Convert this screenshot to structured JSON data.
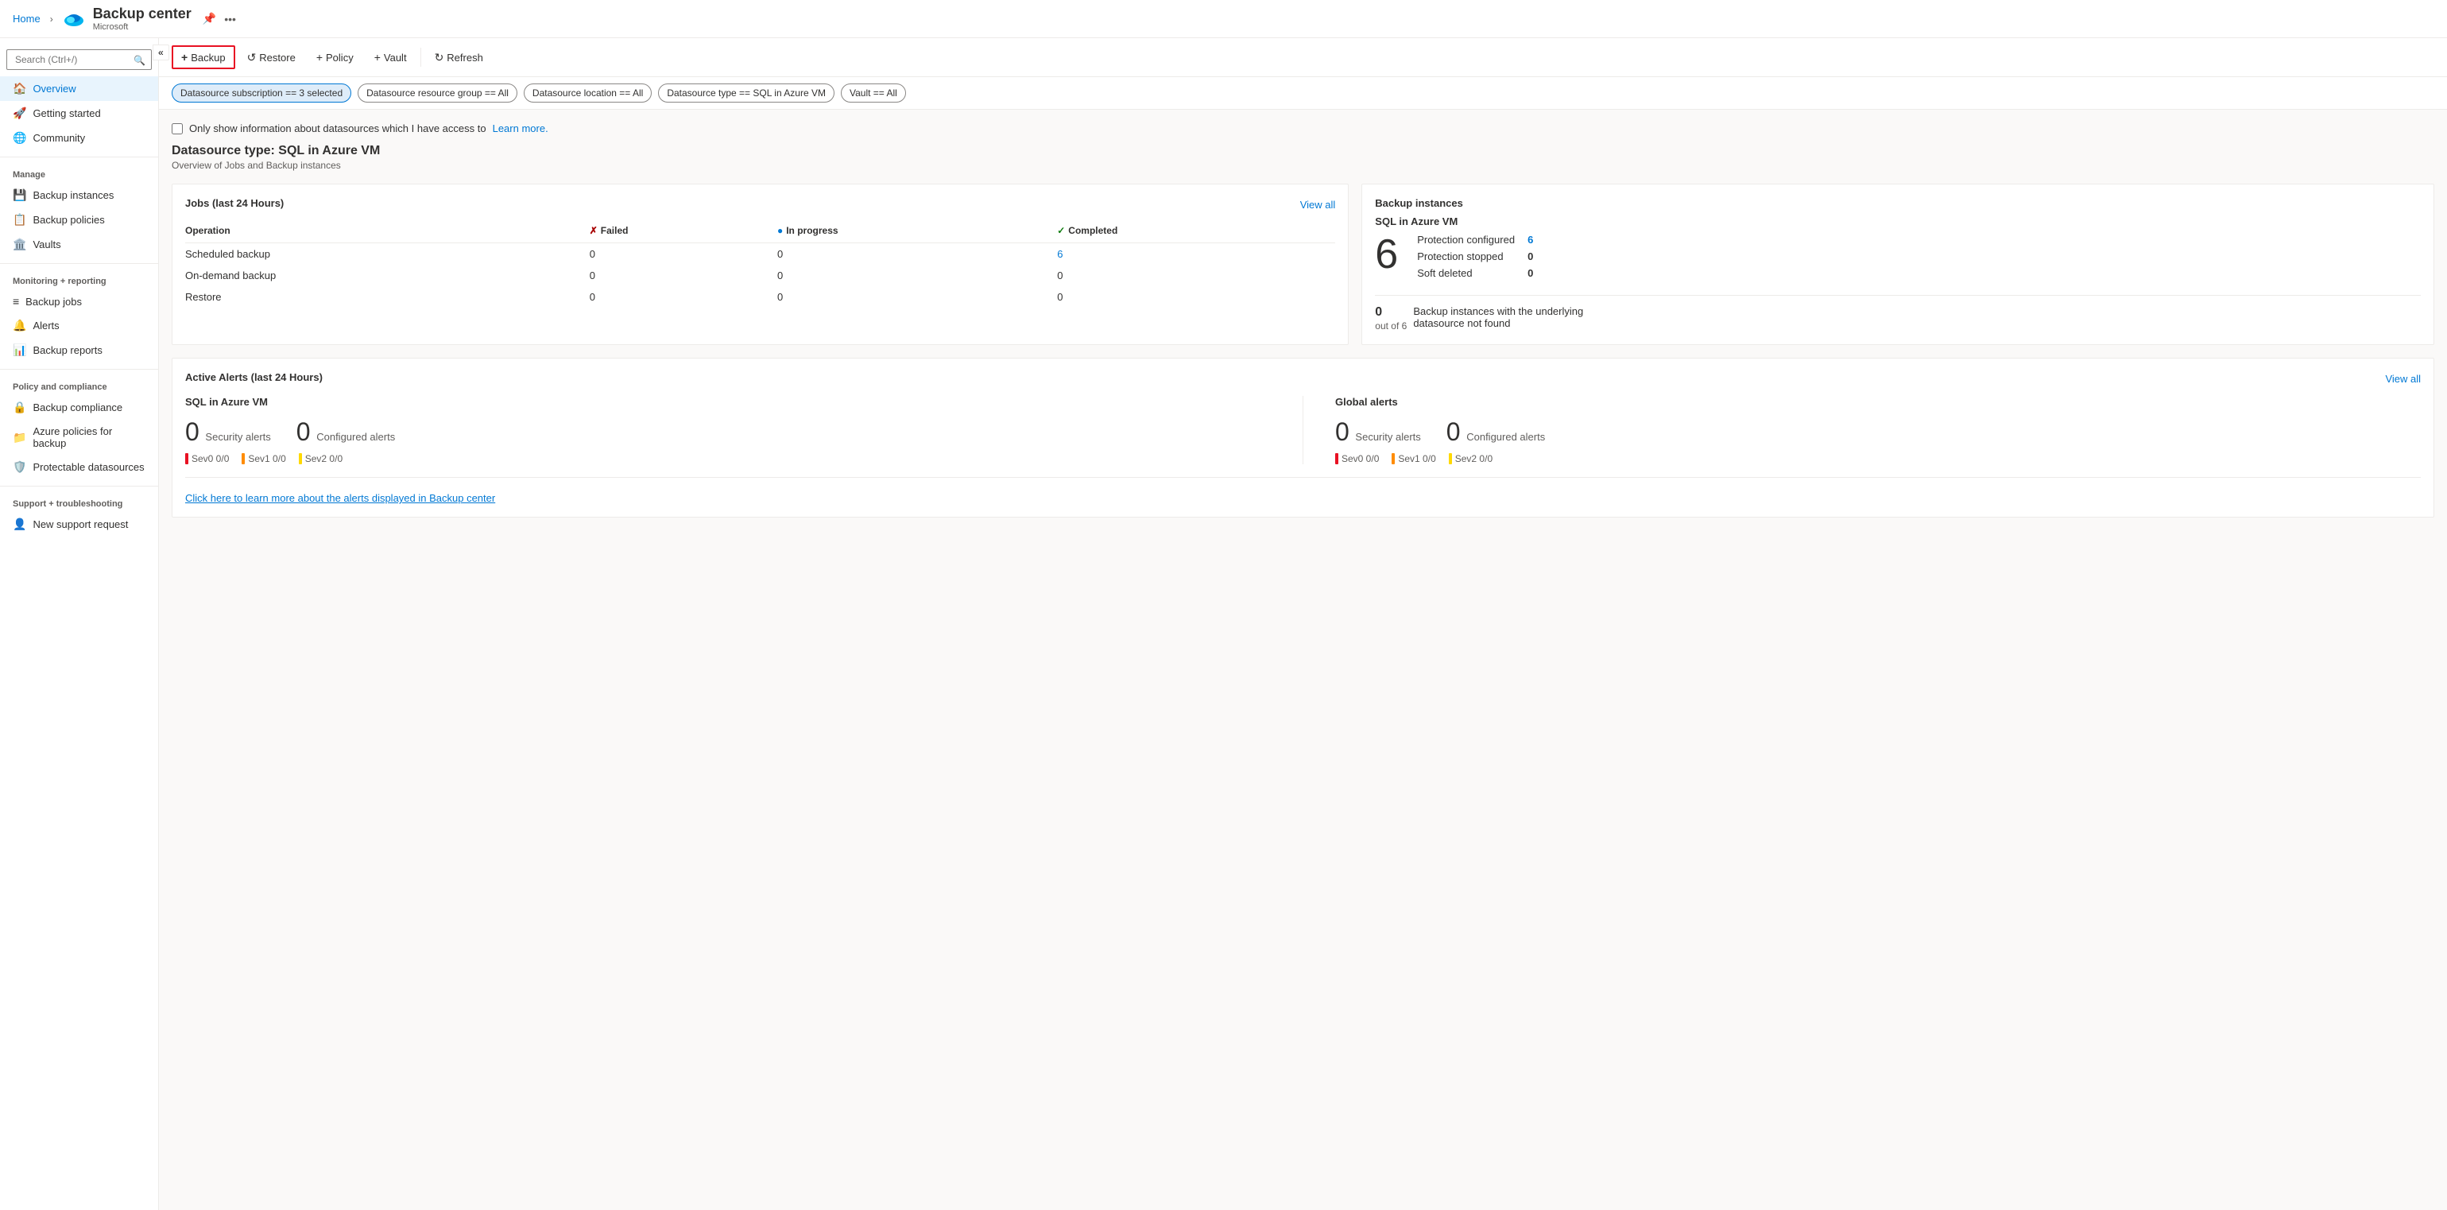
{
  "breadcrumb": {
    "home": "Home",
    "separator": ">"
  },
  "header": {
    "title": "Backup center",
    "subtitle": "Microsoft",
    "pin_label": "📌",
    "more_label": "..."
  },
  "sidebar": {
    "search_placeholder": "Search (Ctrl+/)",
    "collapse_label": "«",
    "items": [
      {
        "id": "overview",
        "label": "Overview",
        "icon": "🏠",
        "active": true,
        "section": null
      },
      {
        "id": "getting-started",
        "label": "Getting started",
        "icon": "🚀",
        "active": false,
        "section": null
      },
      {
        "id": "community",
        "label": "Community",
        "icon": "🌐",
        "active": false,
        "section": null
      },
      {
        "id": "manage-label",
        "label": "Manage",
        "type": "section"
      },
      {
        "id": "backup-instances",
        "label": "Backup instances",
        "icon": "💾",
        "active": false
      },
      {
        "id": "backup-policies",
        "label": "Backup policies",
        "icon": "📋",
        "active": false
      },
      {
        "id": "vaults",
        "label": "Vaults",
        "icon": "🏛️",
        "active": false
      },
      {
        "id": "monitoring-label",
        "label": "Monitoring + reporting",
        "type": "section"
      },
      {
        "id": "backup-jobs",
        "label": "Backup jobs",
        "icon": "≡",
        "active": false
      },
      {
        "id": "alerts",
        "label": "Alerts",
        "icon": "🔔",
        "active": false
      },
      {
        "id": "backup-reports",
        "label": "Backup reports",
        "icon": "📊",
        "active": false
      },
      {
        "id": "policy-label",
        "label": "Policy and compliance",
        "type": "section"
      },
      {
        "id": "backup-compliance",
        "label": "Backup compliance",
        "icon": "🔒",
        "active": false
      },
      {
        "id": "azure-policies",
        "label": "Azure policies for backup",
        "icon": "📁",
        "active": false
      },
      {
        "id": "protectable-ds",
        "label": "Protectable datasources",
        "icon": "🛡️",
        "active": false
      },
      {
        "id": "support-label",
        "label": "Support + troubleshooting",
        "type": "section"
      },
      {
        "id": "new-support",
        "label": "New support request",
        "icon": "👤",
        "active": false
      }
    ]
  },
  "toolbar": {
    "backup_label": "Backup",
    "restore_label": "Restore",
    "policy_label": "Policy",
    "vault_label": "Vault",
    "refresh_label": "Refresh"
  },
  "filters": {
    "items": [
      {
        "label": "Datasource subscription == 3 selected",
        "active": true
      },
      {
        "label": "Datasource resource group == All",
        "active": false
      },
      {
        "label": "Datasource location == All",
        "active": false
      },
      {
        "label": "Datasource type == SQL in Azure VM",
        "active": false
      },
      {
        "label": "Vault == All",
        "active": false
      }
    ]
  },
  "checkbox": {
    "label": "Only show information about datasources which I have access to",
    "learn_more": "Learn more."
  },
  "datasource": {
    "title": "Datasource type: SQL in Azure VM",
    "subtitle": "Overview of Jobs and Backup instances"
  },
  "jobs_card": {
    "title": "Jobs (last 24 Hours)",
    "view_all": "View all",
    "columns": [
      "Operation",
      "Failed",
      "In progress",
      "Completed"
    ],
    "rows": [
      {
        "operation": "Scheduled backup",
        "failed": "0",
        "in_progress": "0",
        "completed": "6"
      },
      {
        "operation": "On-demand backup",
        "failed": "0",
        "in_progress": "0",
        "completed": "0"
      },
      {
        "operation": "Restore",
        "failed": "0",
        "in_progress": "0",
        "completed": "0"
      }
    ],
    "status_icons": {
      "failed": "✗",
      "in_progress": "🔄",
      "completed": "✓"
    }
  },
  "backup_instances_card": {
    "title": "Backup instances",
    "subtitle": "SQL in Azure VM",
    "big_number": "6",
    "protection_configured_label": "Protection configured",
    "protection_configured_value": "6",
    "protection_stopped_label": "Protection stopped",
    "protection_stopped_value": "0",
    "soft_deleted_label": "Soft deleted",
    "soft_deleted_value": "0",
    "bottom_count": "0",
    "bottom_out_of": "out of 6",
    "bottom_desc": "Backup instances with the underlying datasource not found"
  },
  "active_alerts_card": {
    "title": "Active Alerts (last 24 Hours)",
    "view_all": "View all",
    "sql_section": {
      "title": "SQL in Azure VM",
      "security_alerts_count": "0",
      "security_alerts_label": "Security alerts",
      "configured_alerts_count": "0",
      "configured_alerts_label": "Configured alerts",
      "sev0": "Sev0  0/0",
      "sev1": "Sev1  0/0",
      "sev2": "Sev2  0/0"
    },
    "global_section": {
      "title": "Global alerts",
      "security_alerts_count": "0",
      "security_alerts_label": "Security alerts",
      "configured_alerts_count": "0",
      "configured_alerts_label": "Configured alerts",
      "sev0": "Sev0  0/0",
      "sev1": "Sev1  0/0",
      "sev2": "Sev2  0/0"
    },
    "learn_more_link": "Click here to learn more about the alerts displayed in Backup center"
  },
  "colors": {
    "accent": "#0078d4",
    "error": "#a80000",
    "success": "#107c10",
    "warning": "#ff8c00",
    "border_active": "#e81123"
  }
}
